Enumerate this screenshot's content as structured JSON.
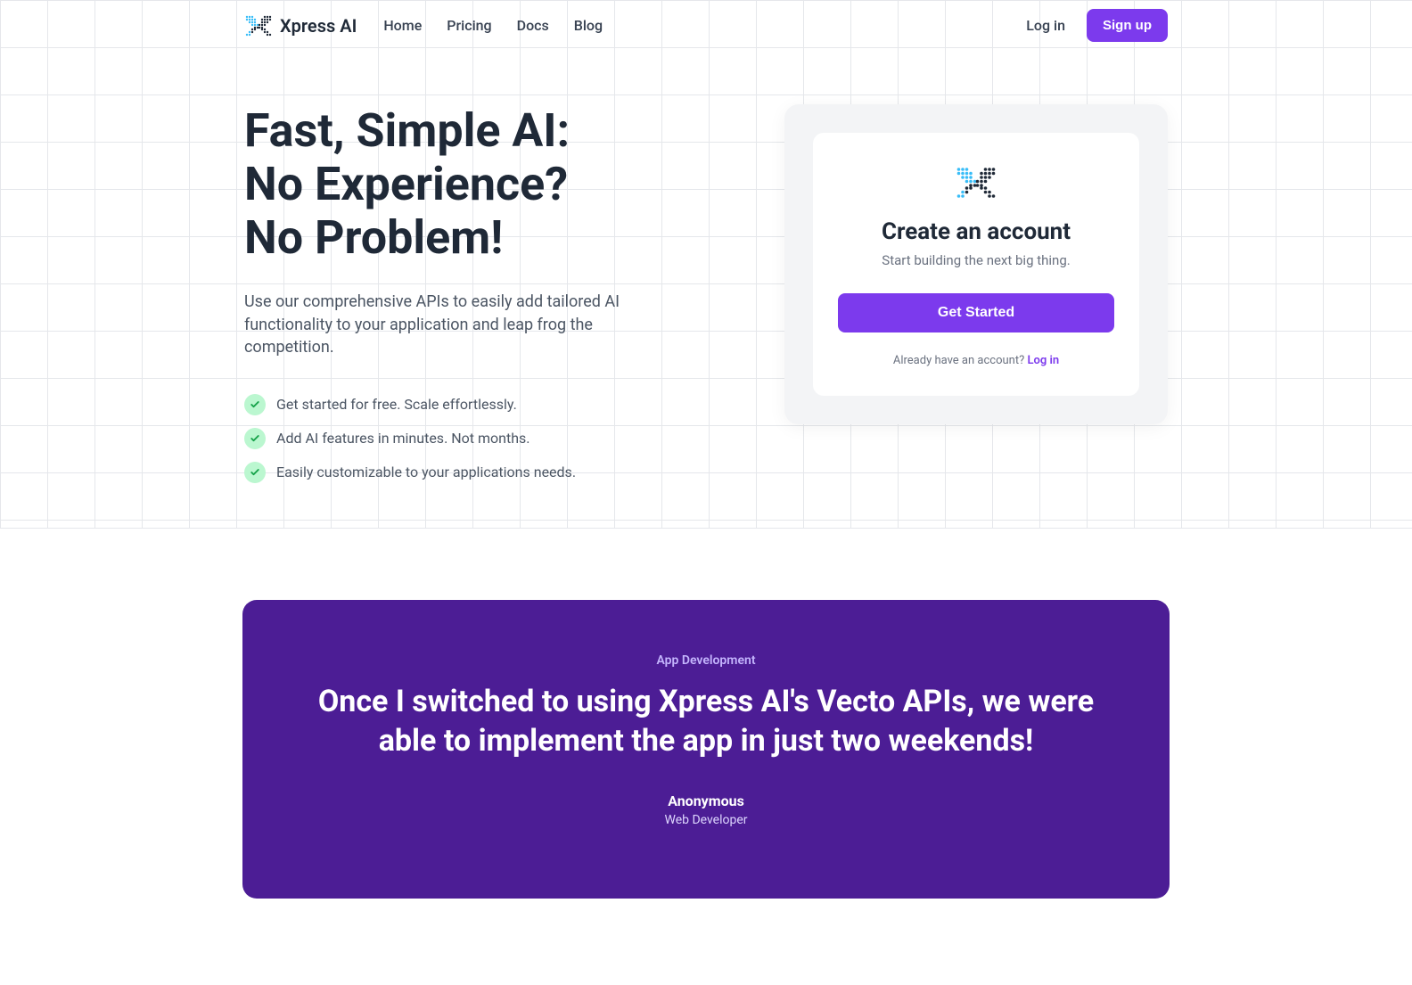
{
  "brand": "Xpress AI",
  "nav": {
    "links": [
      "Home",
      "Pricing",
      "Docs",
      "Blog"
    ],
    "login": "Log in",
    "signup": "Sign up"
  },
  "hero": {
    "title_line1": "Fast, Simple AI:",
    "title_line2": "No Experience?",
    "title_line3": "No Problem!",
    "subtitle": "Use our comprehensive APIs to easily add tailored AI functionality to your application and leap frog the competition.",
    "features": [
      "Get started for free. Scale effortlessly.",
      "Add AI features in minutes. Not months.",
      "Easily customizable to your applications needs."
    ]
  },
  "signup_card": {
    "title": "Create an account",
    "subtitle": "Start building the next big thing.",
    "cta": "Get Started",
    "footer_text": "Already have an account? ",
    "footer_link": "Log in"
  },
  "testimonial": {
    "category": "App Development",
    "quote": "Once I switched to using Xpress AI's Vecto APIs, we were able to implement the app in just two weekends!",
    "author": "Anonymous",
    "role": "Web Developer"
  }
}
